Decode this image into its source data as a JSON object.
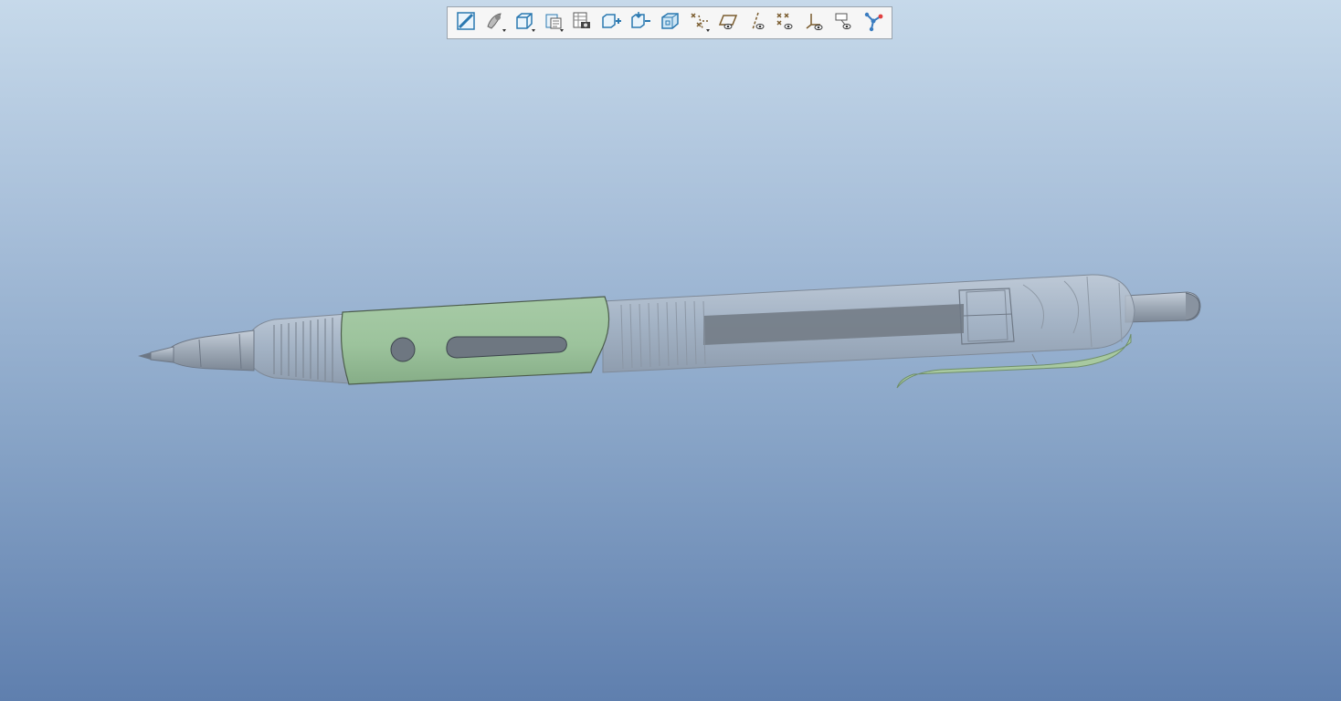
{
  "app": {
    "view_background": {
      "top": "#c6d9ea",
      "bottom": "#5f7fae"
    }
  },
  "toolbar": {
    "buttons": [
      {
        "icon": "refit-icon",
        "has_dropdown": false
      },
      {
        "icon": "appearance-icon",
        "has_dropdown": true
      },
      {
        "icon": "display-style-icon",
        "has_dropdown": true
      },
      {
        "icon": "saved-orientations-icon",
        "has_dropdown": true
      },
      {
        "icon": "view-manager-icon",
        "has_dropdown": false
      },
      {
        "icon": "zoom-in-icon",
        "has_dropdown": false
      },
      {
        "icon": "zoom-out-icon",
        "has_dropdown": false
      },
      {
        "icon": "perspective-view-icon",
        "has_dropdown": false
      },
      {
        "icon": "datum-display-filters-icon",
        "has_dropdown": true
      },
      {
        "icon": "plane-display-icon",
        "has_dropdown": false
      },
      {
        "icon": "axis-display-icon",
        "has_dropdown": false
      },
      {
        "icon": "point-display-icon",
        "has_dropdown": false
      },
      {
        "icon": "csys-display-icon",
        "has_dropdown": false
      },
      {
        "icon": "annotation-display-icon",
        "has_dropdown": false
      },
      {
        "icon": "spin-center-icon",
        "has_dropdown": false
      }
    ]
  },
  "model": {
    "name": "",
    "colors": {
      "grip": "#9cc39c",
      "body": "#a9b4c2",
      "body_edge": "#7f8a98",
      "refill": "#737c86",
      "clip": "#a8c9a0"
    }
  }
}
